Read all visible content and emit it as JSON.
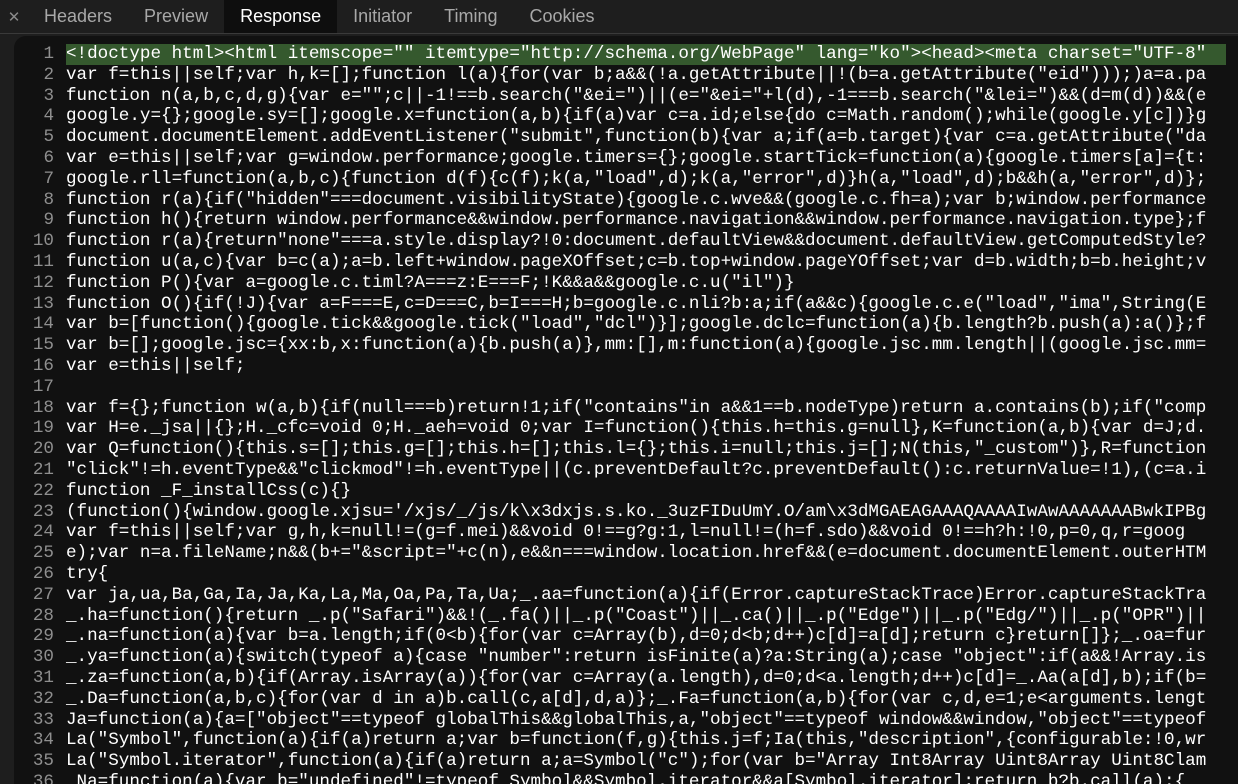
{
  "close_icon": "close-icon",
  "tabs": [
    {
      "label": "Headers",
      "active": false
    },
    {
      "label": "Preview",
      "active": false
    },
    {
      "label": "Response",
      "active": true
    },
    {
      "label": "Initiator",
      "active": false
    },
    {
      "label": "Timing",
      "active": false
    },
    {
      "label": "Cookies",
      "active": false
    }
  ],
  "code_lines": [
    {
      "n": "1",
      "text": "<!doctype html><html itemscope=\"\" itemtype=\"http://schema.org/WebPage\" lang=\"ko\"><head><meta charset=\"UTF-8\""
    },
    {
      "n": "2",
      "text": "var f=this||self;var h,k=[];function l(a){for(var b;a&&(!a.getAttribute||!(b=a.getAttribute(\"eid\")));)a=a.pa"
    },
    {
      "n": "3",
      "text": "function n(a,b,c,d,g){var e=\"\";c||-1!==b.search(\"&ei=\")||(e=\"&ei=\"+l(d),-1===b.search(\"&lei=\")&&(d=m(d))&&(e"
    },
    {
      "n": "4",
      "text": "google.y={};google.sy=[];google.x=function(a,b){if(a)var c=a.id;else{do c=Math.random();while(google.y[c])}g"
    },
    {
      "n": "5",
      "text": "document.documentElement.addEventListener(\"submit\",function(b){var a;if(a=b.target){var c=a.getAttribute(\"da"
    },
    {
      "n": "6",
      "text": "var e=this||self;var g=window.performance;google.timers={};google.startTick=function(a){google.timers[a]={t:"
    },
    {
      "n": "7",
      "text": "google.rll=function(a,b,c){function d(f){c(f);k(a,\"load\",d);k(a,\"error\",d)}h(a,\"load\",d);b&&h(a,\"error\",d)};"
    },
    {
      "n": "8",
      "text": "function r(a){if(\"hidden\"===document.visibilityState){google.c.wve&&(google.c.fh=a);var b;window.performance"
    },
    {
      "n": "9",
      "text": "function h(){return window.performance&&window.performance.navigation&&window.performance.navigation.type};f"
    },
    {
      "n": "10",
      "text": "function r(a){return\"none\"===a.style.display?!0:document.defaultView&&document.defaultView.getComputedStyle?"
    },
    {
      "n": "11",
      "text": "function u(a,c){var b=c(a);a=b.left+window.pageXOffset;c=b.top+window.pageYOffset;var d=b.width;b=b.height;v"
    },
    {
      "n": "12",
      "text": "function P(){var a=google.c.timl?A===z:E===F;!K&&a&&google.c.u(\"il\")}"
    },
    {
      "n": "13",
      "text": "function O(){if(!J){var a=F===E,c=D===C,b=I===H;b=google.c.nli?b:a;if(a&&c){google.c.e(\"load\",\"ima\",String(E"
    },
    {
      "n": "14",
      "text": "var b=[function(){google.tick&&google.tick(\"load\",\"dcl\")}];google.dclc=function(a){b.length?b.push(a):a()};f"
    },
    {
      "n": "15",
      "text": "var b=[];google.jsc={xx:b,x:function(a){b.push(a)},mm:[],m:function(a){google.jsc.mm.length||(google.jsc.mm="
    },
    {
      "n": "16",
      "text": "var e=this||self;"
    },
    {
      "n": "17",
      "text": ""
    },
    {
      "n": "18",
      "text": "var f={};function w(a,b){if(null===b)return!1;if(\"contains\"in a&&1==b.nodeType)return a.contains(b);if(\"comp"
    },
    {
      "n": "19",
      "text": "var H=e._jsa||{};H._cfc=void 0;H._aeh=void 0;var I=function(){this.h=this.g=null},K=function(a,b){var d=J;d."
    },
    {
      "n": "20",
      "text": "var Q=function(){this.s=[];this.g=[];this.h=[];this.l={};this.i=null;this.j=[];N(this,\"_custom\")},R=function"
    },
    {
      "n": "21",
      "text": "\"click\"!=h.eventType&&\"clickmod\"!=h.eventType||(c.preventDefault?c.preventDefault():c.returnValue=!1),(c=a.i"
    },
    {
      "n": "22",
      "text": "function _F_installCss(c){}"
    },
    {
      "n": "23",
      "text": "(function(){window.google.xjsu='/xjs/_/js/k\\x3dxjs.s.ko._3uzFIDuUmY.O/am\\x3dMGAEAGAAAQAAAAIwAwAAAAAAABwkIPBg"
    },
    {
      "n": "24",
      "text": "var f=this||self;var g,h,k=null!=(g=f.mei)&&void 0!==g?g:1,l=null!=(h=f.sdo)&&void 0!==h?h:!0,p=0,q,r=goog"
    },
    {
      "n": "25",
      "text": "e);var n=a.fileName;n&&(b+=\"&script=\"+c(n),e&&n===window.location.href&&(e=document.documentElement.outerHTM"
    },
    {
      "n": "26",
      "text": "try{"
    },
    {
      "n": "27",
      "text": "var ja,ua,Ba,Ga,Ia,Ja,Ka,La,Ma,Oa,Pa,Ta,Ua;_.aa=function(a){if(Error.captureStackTrace)Error.captureStackTra"
    },
    {
      "n": "28",
      "text": "_.ha=function(){return _.p(\"Safari\")&&!(_.fa()||_.p(\"Coast\")||_.ca()||_.p(\"Edge\")||_.p(\"Edg/\")||_.p(\"OPR\")||"
    },
    {
      "n": "29",
      "text": "_.na=function(a){var b=a.length;if(0<b){for(var c=Array(b),d=0;d<b;d++)c[d]=a[d];return c}return[]};_.oa=fur"
    },
    {
      "n": "30",
      "text": "_.ya=function(a){switch(typeof a){case \"number\":return isFinite(a)?a:String(a);case \"object\":if(a&&!Array.is"
    },
    {
      "n": "31",
      "text": "_.za=function(a,b){if(Array.isArray(a)){for(var c=Array(a.length),d=0;d<a.length;d++)c[d]=_.Aa(a[d],b);if(b="
    },
    {
      "n": "32",
      "text": "_.Da=function(a,b,c){for(var d in a)b.call(c,a[d],d,a)};_.Fa=function(a,b){for(var c,d,e=1;e<arguments.lengt"
    },
    {
      "n": "33",
      "text": "Ja=function(a){a=[\"object\"==typeof globalThis&&globalThis,a,\"object\"==typeof window&&window,\"object\"==typeof"
    },
    {
      "n": "34",
      "text": "La(\"Symbol\",function(a){if(a)return a;var b=function(f,g){this.j=f;Ia(this,\"description\",{configurable:!0,wr"
    },
    {
      "n": "35",
      "text": "La(\"Symbol.iterator\",function(a){if(a)return a;a=Symbol(\"c\");for(var b=\"Array Int8Array Uint8Array Uint8Clam"
    },
    {
      "n": "36",
      "text": "_Na=function(a){var b=\"undefined\"!=typeof Symbol&&Symbol.iterator&&a[Symbol.iterator];return b?b.call(a):{"
    }
  ]
}
